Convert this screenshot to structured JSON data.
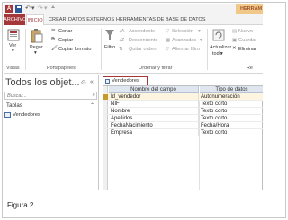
{
  "titlebar": {
    "app_logo": "A",
    "context_label": "HERRAM"
  },
  "tabs": [
    "ARCHIVO",
    "INICIO",
    "CREAR",
    "DATOS EXTERNOS",
    "HERRAMIENTAS DE BASE DE DATOS"
  ],
  "ribbon": {
    "vistas": {
      "ver": "Ver",
      "label": "Vistas"
    },
    "portapapeles": {
      "pegar": "Pegar",
      "cortar": "Cortar",
      "copiar": "Copiar",
      "copiar_formato": "Copiar formato",
      "label": "Portapapeles"
    },
    "ordenar": {
      "filtro": "Filtro",
      "ascendente": "Ascendente",
      "descendente": "Descendente",
      "quitar_orden": "Quitar orden",
      "seleccion": "Selección",
      "avanzadas": "Avanzadas",
      "alternar_filtro": "Alternar filtro",
      "label": "Ordenar y filtrar"
    },
    "registros": {
      "actualizar": "Actualizar",
      "todo": "todo",
      "nuevo": "Nuevo",
      "guardar": "Guardar",
      "eliminar": "Eliminar",
      "label": "Re"
    }
  },
  "nav": {
    "title": "Todos los objet...",
    "search_placeholder": "Buscar...",
    "section": "Tablas",
    "items": [
      "Vendedores"
    ]
  },
  "document": {
    "tab_label": "Vendedores",
    "columns": [
      "Nombre del campo",
      "Tipo de datos"
    ],
    "rows": [
      {
        "name": "Id_vendedor",
        "type": "Autonumeración"
      },
      {
        "name": "NIF",
        "type": "Texto corto"
      },
      {
        "name": "Nombre",
        "type": "Texto corto"
      },
      {
        "name": "Apellidos",
        "type": "Texto corto"
      },
      {
        "name": "FechaNacimiento",
        "type": "Fecha/Hora"
      },
      {
        "name": "Empresa",
        "type": "Texto corto"
      }
    ]
  },
  "caption": "Figura 2",
  "colors": {
    "access_red": "#a4373a",
    "header_blue": "#dfe6ef",
    "context_orange": "#f0c988"
  }
}
